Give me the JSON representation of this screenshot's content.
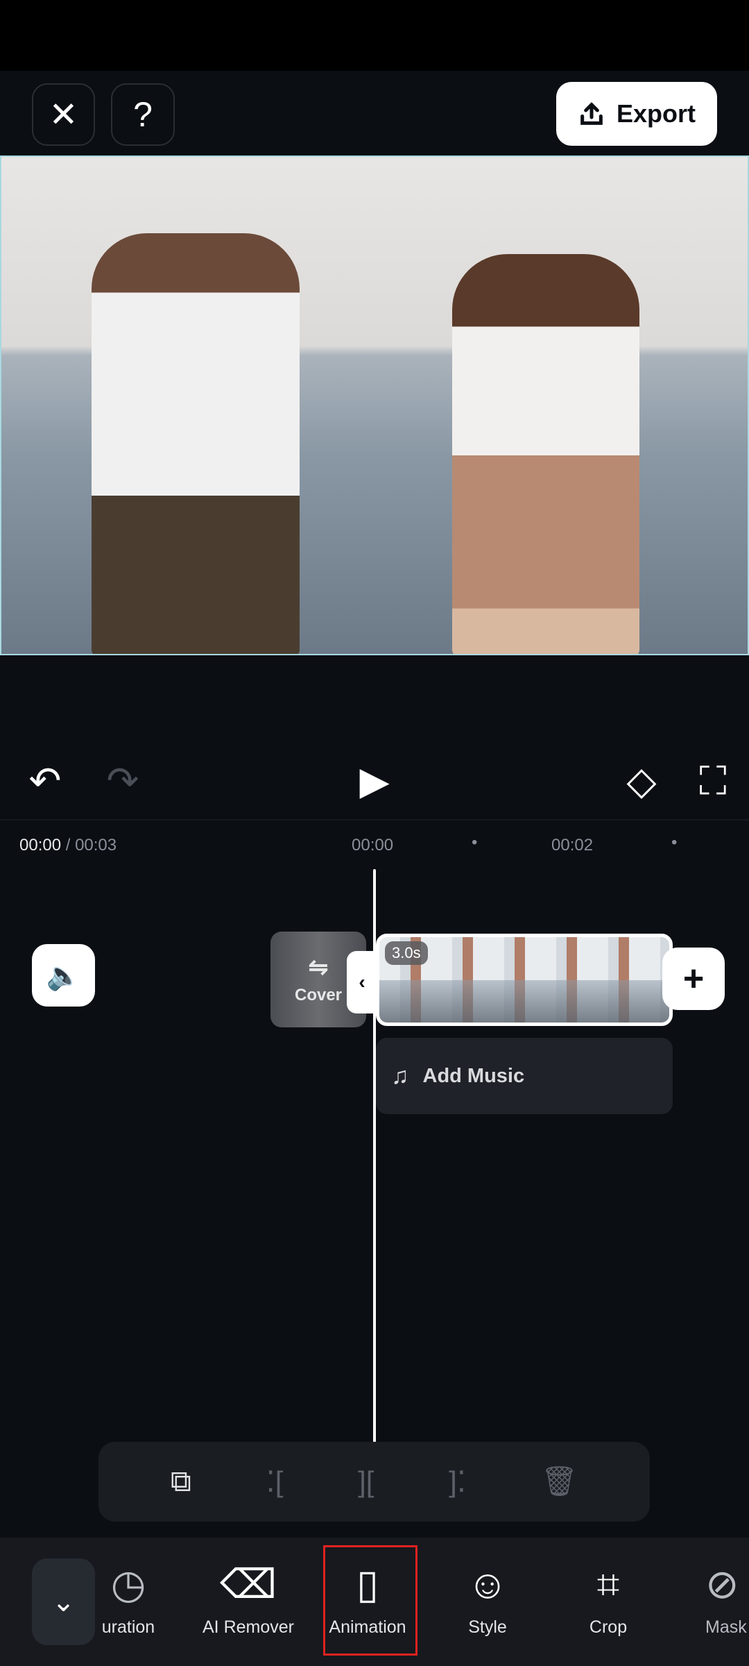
{
  "header": {
    "close_icon": "close-icon",
    "help_label": "?",
    "export_label": "Export",
    "export_icon": "upload-icon"
  },
  "player": {
    "undo_icon": "undo-icon",
    "redo_icon": "redo-icon",
    "play_icon": "play-icon",
    "keyframe_icon": "add-keyframe-icon",
    "fullscreen_icon": "fullscreen-icon"
  },
  "timeline": {
    "current_time": "00:00",
    "total_time": "/ 00:03",
    "ruler": [
      "00:00",
      "00:02"
    ],
    "clip_duration": "3.0s",
    "cover_label": "Cover",
    "add_music_label": "Add Music"
  },
  "edit_tools": [
    "copy",
    "split-left",
    "split",
    "split-right",
    "delete"
  ],
  "bottom_nav": {
    "items": [
      {
        "label": "uration",
        "icon": "clock-icon"
      },
      {
        "label": "AI Remover",
        "icon": "ai-eraser-icon"
      },
      {
        "label": "Animation",
        "icon": "animation-icon",
        "highlighted": true
      },
      {
        "label": "Style",
        "icon": "style-icon"
      },
      {
        "label": "Crop",
        "icon": "crop-icon"
      },
      {
        "label": "Mask",
        "icon": "mask-icon"
      }
    ]
  },
  "colors": {
    "background": "#0b0e13",
    "highlight": "#e0221f",
    "preview_border": "#a9d8e0"
  }
}
